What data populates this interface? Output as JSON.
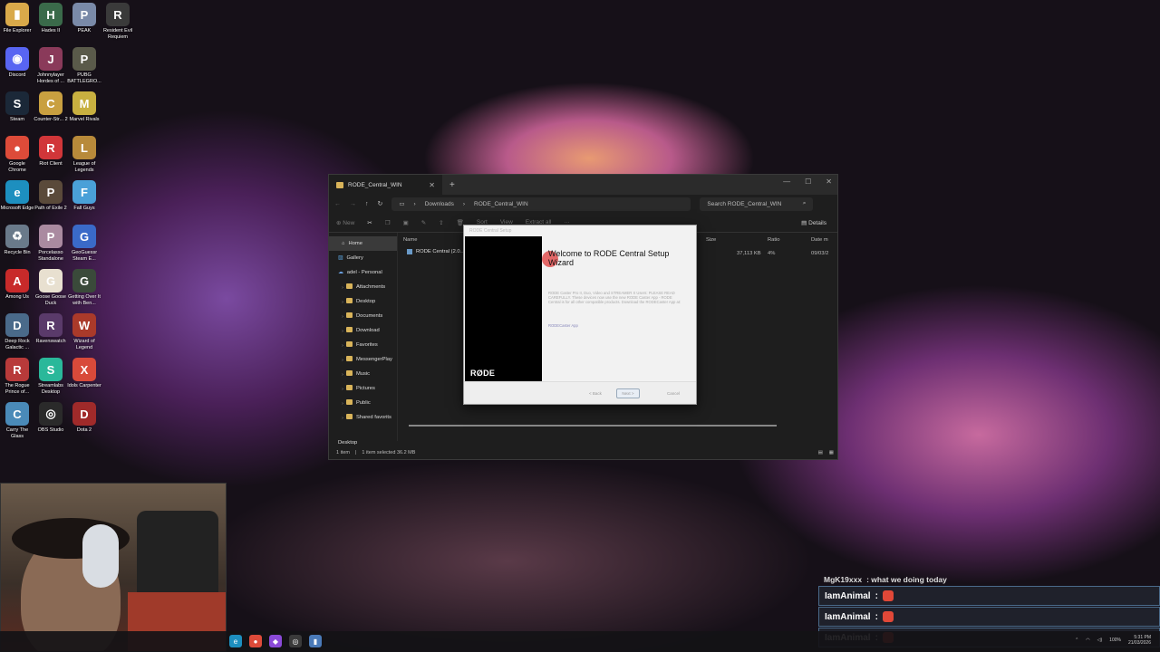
{
  "desktop": {
    "icons": [
      {
        "label": "File Explorer",
        "icon": "folder-icon",
        "color": "#d9a94a",
        "glyph": "▮"
      },
      {
        "label": "Hades II",
        "icon": "hades-icon",
        "color": "#3a6a4a",
        "glyph": "H"
      },
      {
        "label": "PEAK",
        "icon": "peak-icon",
        "color": "#7a8aa8",
        "glyph": "P"
      },
      {
        "label": "Resident Evil Requiem",
        "icon": "re-icon",
        "color": "#3a3a3a",
        "glyph": "R"
      },
      {
        "label": "Discord",
        "icon": "discord-icon",
        "color": "#5865f2",
        "glyph": "◉"
      },
      {
        "label": "Johnnylayer Hordes of ...",
        "icon": "hordes-icon",
        "color": "#8a3a5a",
        "glyph": "J"
      },
      {
        "label": "PUBG BATTLEGRO...",
        "icon": "pubg-icon",
        "color": "#5a5a4a",
        "glyph": "P"
      },
      {
        "label": "Steam",
        "icon": "steam-icon",
        "color": "#1b2838",
        "glyph": "S"
      },
      {
        "label": "Counter-Str... 2",
        "icon": "cs2-icon",
        "color": "#c9a040",
        "glyph": "C"
      },
      {
        "label": "Marvel Rivals",
        "icon": "marvel-icon",
        "color": "#c8b040",
        "glyph": "M"
      },
      {
        "label": "Google Chrome",
        "icon": "chrome-icon",
        "color": "#dd4b39",
        "glyph": "●"
      },
      {
        "label": "Riot Client",
        "icon": "riot-icon",
        "color": "#d13639",
        "glyph": "R"
      },
      {
        "label": "League of Legends",
        "icon": "lol-icon",
        "color": "#b88a3a",
        "glyph": "L"
      },
      {
        "label": "Microsoft Edge",
        "icon": "edge-icon",
        "color": "#1d8fbf",
        "glyph": "e"
      },
      {
        "label": "Path of Exile 2",
        "icon": "poe-icon",
        "color": "#5a4a3a",
        "glyph": "P"
      },
      {
        "label": "Fall Guys",
        "icon": "fallguys-icon",
        "color": "#4aa0d8",
        "glyph": "F"
      },
      {
        "label": "Recycle Bin",
        "icon": "recycle-bin-icon",
        "color": "#6a7a8a",
        "glyph": "♻"
      },
      {
        "label": "Porcelasso Standalone",
        "icon": "porcelasso-icon",
        "color": "#aa8aa0",
        "glyph": "P"
      },
      {
        "label": "GeoGuessr Steam E...",
        "icon": "geoguessr-icon",
        "color": "#3a6ac8",
        "glyph": "G"
      },
      {
        "label": "Among Us",
        "icon": "among-us-icon",
        "color": "#c82a2a",
        "glyph": "A"
      },
      {
        "label": "Goose Goose Duck",
        "icon": "goose-icon",
        "color": "#e8e0d0",
        "glyph": "G"
      },
      {
        "label": "Getting Over It with Ben...",
        "icon": "getting-over-it-icon",
        "color": "#3a4a3a",
        "glyph": "G"
      },
      {
        "label": "Deep Rock Galactic ...",
        "icon": "drg-icon",
        "color": "#4a6a8a",
        "glyph": "D"
      },
      {
        "label": "Ravenswatch",
        "icon": "ravenswatch-icon",
        "color": "#5a3a6a",
        "glyph": "R"
      },
      {
        "label": "Wizard of Legend",
        "icon": "wizard-icon",
        "color": "#aa3a2a",
        "glyph": "W"
      },
      {
        "label": "The Rogue Prince of...",
        "icon": "rogue-prince-icon",
        "color": "#b83a3a",
        "glyph": "R"
      },
      {
        "label": "Streamlabs Desktop",
        "icon": "streamlabs-icon",
        "color": "#2ab89a",
        "glyph": "S"
      },
      {
        "label": "Idols Carpenter",
        "icon": "idols-icon",
        "color": "#d84a3a",
        "glyph": "X"
      },
      {
        "label": "Carry The Glass",
        "icon": "carry-glass-icon",
        "color": "#4a8ab8",
        "glyph": "C"
      },
      {
        "label": "OBS Studio",
        "icon": "obs-icon",
        "color": "#2a2a2a",
        "glyph": "◎"
      },
      {
        "label": "Dota 2",
        "icon": "dota-icon",
        "color": "#a02a2a",
        "glyph": "D"
      }
    ]
  },
  "explorer": {
    "tab_title": "RODE_Central_WIN",
    "breadcrumb": [
      "Downloads",
      "RODE_Central_WIN"
    ],
    "search_placeholder": "Search RODE_Central_WIN",
    "toolbar": {
      "new": "New",
      "sort": "Sort",
      "view": "View",
      "extract": "Extract all",
      "details": "Details"
    },
    "nav": [
      {
        "label": "Home",
        "kind": "home"
      },
      {
        "label": "Gallery",
        "kind": "plain"
      },
      {
        "label": "adel - Personal",
        "kind": "cloud"
      },
      {
        "label": "Attachments",
        "kind": "sub"
      },
      {
        "label": "Desktop",
        "kind": "sub"
      },
      {
        "label": "Documents",
        "kind": "sub"
      },
      {
        "label": "Download",
        "kind": "sub"
      },
      {
        "label": "Favorites",
        "kind": "sub"
      },
      {
        "label": "MessengerPlay",
        "kind": "sub"
      },
      {
        "label": "Music",
        "kind": "sub"
      },
      {
        "label": "Pictures",
        "kind": "sub"
      },
      {
        "label": "Public",
        "kind": "sub"
      },
      {
        "label": "Shared favorits",
        "kind": "sub"
      }
    ],
    "nav_bottom": "Desktop",
    "columns": {
      "name": "Name",
      "size": "Size",
      "ratio": "Ratio",
      "date": "Date m"
    },
    "file": {
      "name": "RODE Central (2.0...",
      "size": "37,113 KB",
      "ratio": "4%",
      "date": "09/03/2"
    },
    "status": {
      "items": "1 item",
      "selected": "1 item selected  36.2 MB"
    }
  },
  "wizard": {
    "title": "RODE Central Setup",
    "heading": "Welcome to RODE Central Setup Wizard",
    "body": "RODE Caster Pro II, Duo, Video and STREAMER X Users: PLEASE READ CAREFULLY. These devices now use the new RODE Caster App - RODE Central is for all other compatible products. Download the RODECaster App at:",
    "link": "RODECaster App",
    "logo": "RØDE",
    "buttons": {
      "back": "< Back",
      "next": "Next >",
      "cancel": "Cancel"
    }
  },
  "chat": {
    "messages": [
      {
        "user": "MgK19xxx",
        "text": ": what we doing today"
      },
      {
        "user": "IamAnimal",
        "text": ":"
      },
      {
        "user": "IamAnimal",
        "text": ":"
      },
      {
        "user": "IamAnimal",
        "text": ":"
      }
    ]
  },
  "taskbar": {
    "apps": [
      {
        "icon": "edge-icon",
        "color": "#1d8fbf",
        "glyph": "e"
      },
      {
        "icon": "chrome-icon",
        "color": "#dd4b39",
        "glyph": "●"
      },
      {
        "icon": "twitch-icon",
        "color": "#8a4ad8",
        "glyph": "◆"
      },
      {
        "icon": "obs-icon",
        "color": "#3a3a3a",
        "glyph": "◎"
      },
      {
        "icon": "folder-icon",
        "color": "#4a7ab8",
        "glyph": "▮"
      }
    ],
    "battery": "100%",
    "time": "5:31 PM",
    "date": "21/03/2026"
  }
}
